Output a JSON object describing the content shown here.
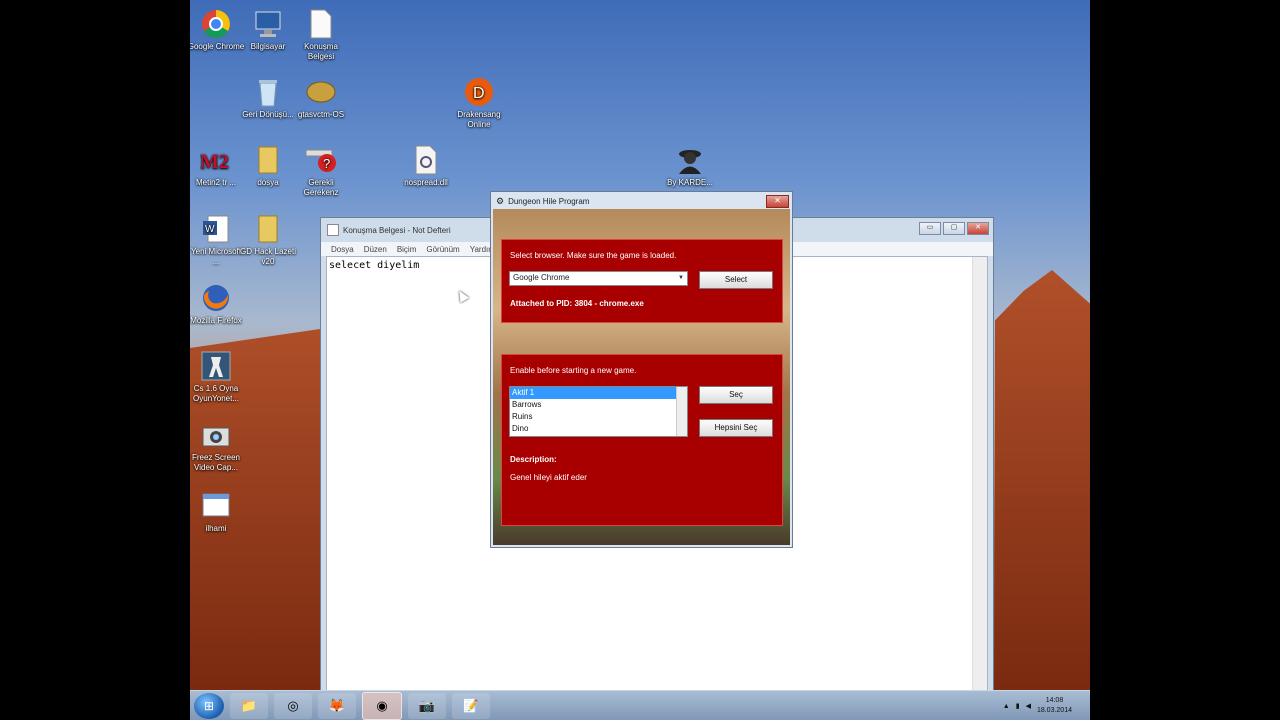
{
  "colors": {
    "panel_red": "#a80000",
    "selection": "#3399ff"
  },
  "desktop": {
    "icons": [
      {
        "label": "Google Chrome",
        "icon": "chrome-icon"
      },
      {
        "label": "Bilgisayar",
        "icon": "computer-icon"
      },
      {
        "label": "Konuşma Belgesi",
        "icon": "document-icon"
      },
      {
        "label": "Geri Dönüşü...",
        "icon": "recycle-bin-icon"
      },
      {
        "label": "gtasvctm-OS",
        "icon": "game-icon"
      },
      {
        "label": "Drakensang Online",
        "icon": "drakensang-icon"
      },
      {
        "label": "Metin2 tr ...",
        "icon": "metin2-icon"
      },
      {
        "label": "dosya",
        "icon": "folder-icon"
      },
      {
        "label": "Gerekli Gerekenz",
        "icon": "help-icon"
      },
      {
        "label": "nospread.dll",
        "icon": "dll-icon"
      },
      {
        "label": "By KARDE...",
        "icon": "agent-icon"
      },
      {
        "label": "Yeni Microsoft ...",
        "icon": "word-icon"
      },
      {
        "label": "GD Hack Lazeti v20",
        "icon": "folder-icon"
      },
      {
        "label": "Mozilla Firefox",
        "icon": "firefox-icon"
      },
      {
        "label": "Cs 1.6 Oyna OyunYonet...",
        "icon": "cs-icon"
      },
      {
        "label": "Freez Screen Video Cap...",
        "icon": "camera-icon"
      },
      {
        "label": "ilhami",
        "icon": "window-icon"
      }
    ]
  },
  "notepad": {
    "title": "Konuşma Belgesi - Not Defteri",
    "menu": [
      "Dosya",
      "Düzen",
      "Biçim",
      "Görünüm",
      "Yardım"
    ],
    "content": "selecet diyelim",
    "btn_min": "▭",
    "btn_max": "▢",
    "btn_close": "✕"
  },
  "dungeon": {
    "title": "Dungeon Hile Program",
    "close": "✕",
    "browser_panel": {
      "instruction": "Select browser. Make sure the game is loaded.",
      "browser_value": "Google Chrome",
      "select_label": "Select",
      "attached": "Attached to PID: 3804 - chrome.exe"
    },
    "cheat_panel": {
      "instruction": "Enable before starting a new game.",
      "items": [
        "Aktif 1",
        "Barrows",
        "Ruins",
        "Dino"
      ],
      "selected_index": 0,
      "sec_label": "Seç",
      "select_all_label": "Hepsini Seç",
      "description_heading": "Description:",
      "description": "Genel hileyi aktif eder"
    }
  },
  "taskbar": {
    "buttons": [
      {
        "icon": "folder-icon",
        "glyph": "📁"
      },
      {
        "icon": "ccleaner-icon",
        "glyph": "◎"
      },
      {
        "icon": "firefox-icon",
        "glyph": "🦊"
      },
      {
        "icon": "chrome-icon",
        "glyph": "◉"
      },
      {
        "icon": "camera-icon",
        "glyph": "📷"
      },
      {
        "icon": "notepad-icon",
        "glyph": "📝"
      }
    ],
    "time": "14:08",
    "date": "18.03.2014"
  }
}
